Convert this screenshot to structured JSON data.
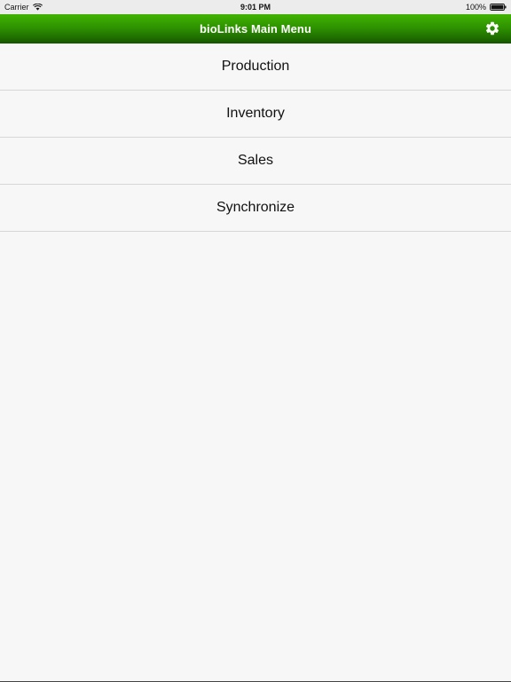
{
  "status_bar": {
    "carrier": "Carrier",
    "time": "9:01 PM",
    "battery": "100%",
    "icons": [
      "wifi-icon",
      "battery-icon"
    ]
  },
  "nav": {
    "title": "bioLinks Main Menu",
    "settings_icon": "gear-icon",
    "colors": {
      "top": "#41b300",
      "bottom": "#175400"
    }
  },
  "menu": {
    "items": [
      {
        "label": "Production"
      },
      {
        "label": "Inventory"
      },
      {
        "label": "Sales"
      },
      {
        "label": "Synchronize"
      }
    ]
  }
}
